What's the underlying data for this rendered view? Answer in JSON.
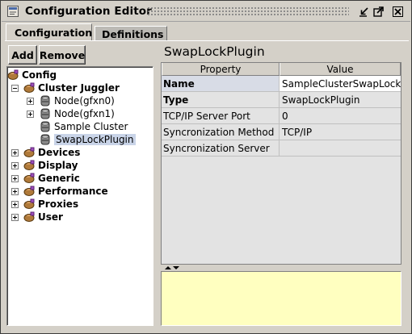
{
  "window": {
    "title": "Configuration Editor",
    "controls": [
      "minimize-icon",
      "maximize-icon",
      "close-icon"
    ]
  },
  "tabs": [
    {
      "label": "Configuration",
      "active": true
    },
    {
      "label": "Definitions",
      "active": false
    }
  ],
  "toolbar": {
    "add_label": "Add",
    "remove_label": "Remove"
  },
  "tree": {
    "root": "Config",
    "cluster": "Cluster Juggler",
    "cluster_children": [
      "Node(gfxn0)",
      "Node(gfxn1)",
      "Sample Cluster",
      "SwapLockPlugin"
    ],
    "selected": "SwapLockPlugin",
    "categories": [
      "Devices",
      "Display",
      "Generic",
      "Performance",
      "Proxies",
      "User"
    ]
  },
  "properties": {
    "title": "SwapLockPlugin",
    "columns": [
      "Property",
      "Value"
    ],
    "rows": [
      {
        "name": "Name",
        "value": "SampleClusterSwapLock",
        "bold": true
      },
      {
        "name": "Type",
        "value": "SwapLockPlugin",
        "bold": true
      },
      {
        "name": "TCP/IP Server Port",
        "value": "0",
        "bold": false
      },
      {
        "name": "Syncronization Method",
        "value": "TCP/IP",
        "bold": false
      },
      {
        "name": "Syncronization Server",
        "value": "",
        "bold": false
      }
    ]
  },
  "description": ""
}
